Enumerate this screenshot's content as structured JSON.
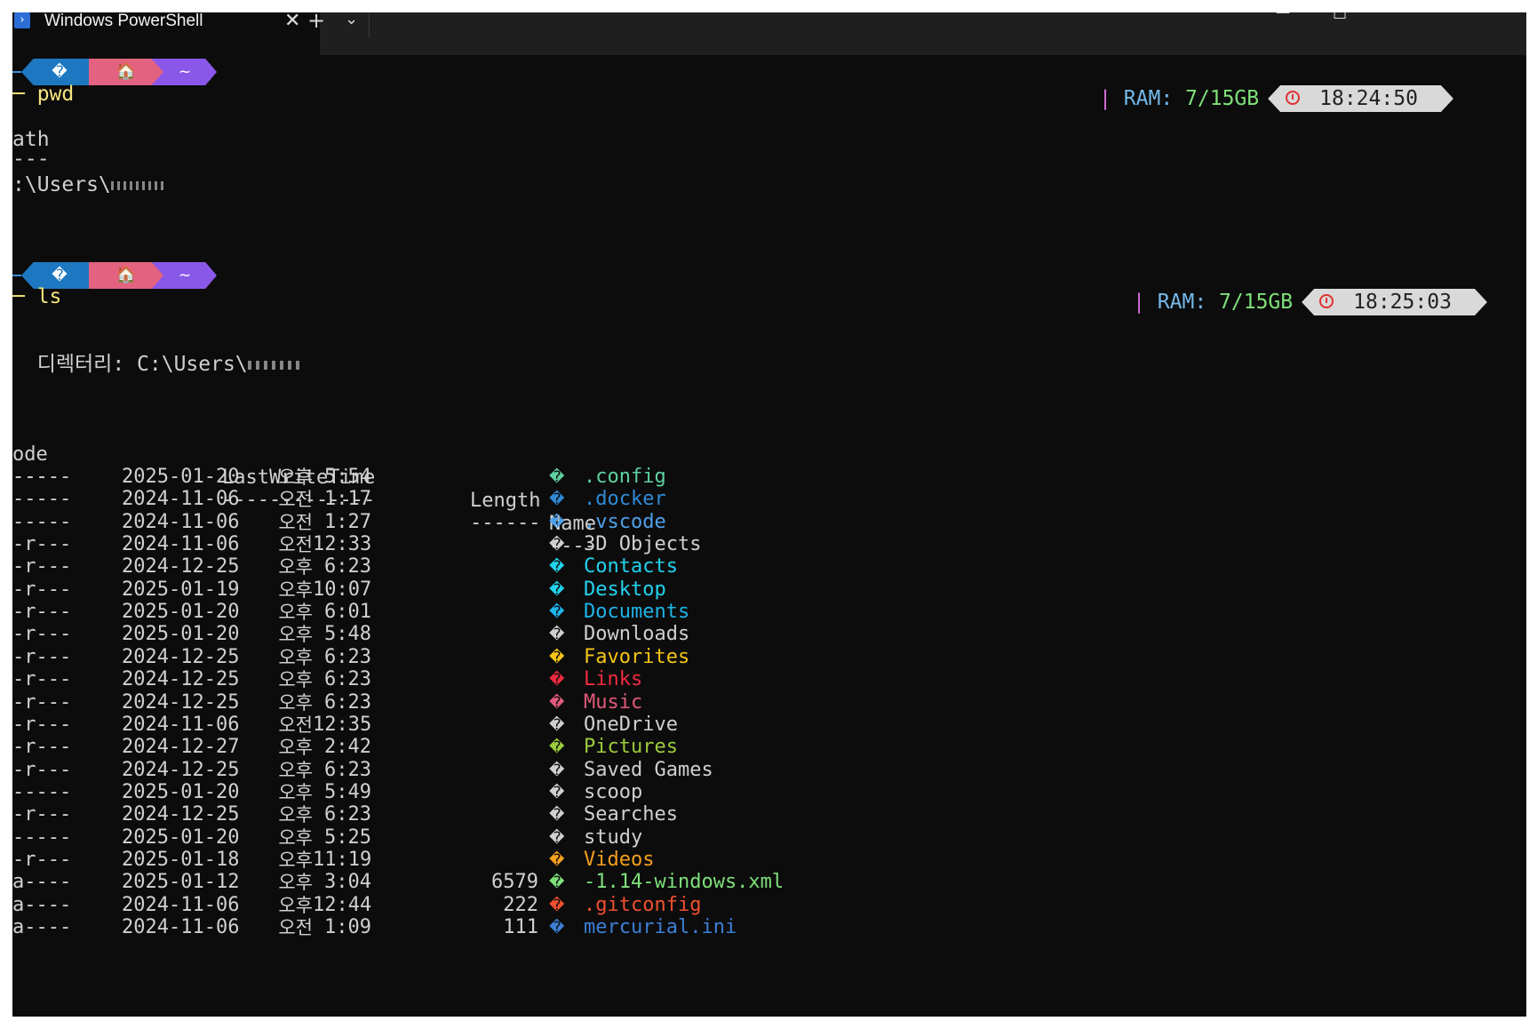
{
  "window": {
    "tab_title": "Windows PowerShell",
    "tab_icon": "powershell-icon",
    "close_glyph": "✕",
    "new_tab_glyph": "+",
    "dropdown_glyph": "⌄",
    "minimize_glyph": "—",
    "maximize_glyph": "☐"
  },
  "prompt1": {
    "seg1_glyph": "�",
    "seg3_glyph": "~",
    "ram_label": "RAM:",
    "ram_value": "7/15GB",
    "time": "18:24:50",
    "command": "─ pwd"
  },
  "pwd_output": {
    "header": "ath",
    "underline": "---",
    "path": ":\\Users\\"
  },
  "prompt2": {
    "seg1_glyph": "�",
    "seg3_glyph": "~",
    "ram_label": "RAM:",
    "ram_value": "7/15GB",
    "time": "18:25:03",
    "command": "─ ls"
  },
  "ls": {
    "directory_line": "  디렉터리: C:\\Users\\",
    "headers": {
      "mode": "ode",
      "lastwrite": "LastWriteTime",
      "length": "Length",
      "name": "Name"
    },
    "underlines": {
      "mode": "---",
      "lastwrite": "-------------",
      "length": "------",
      "name": "----"
    },
    "rows": [
      {
        "mode": "-----",
        "date": "2025-01-20",
        "ampm": "오후",
        "time": "5:54",
        "length": "",
        "icon": "�",
        "name": ".config",
        "color": "#5fd0a0"
      },
      {
        "mode": "-----",
        "date": "2024-11-06",
        "ampm": "오전",
        "time": "1:17",
        "length": "",
        "icon": "�",
        "name": ".docker",
        "color": "#2f8ad6"
      },
      {
        "mode": "-----",
        "date": "2024-11-06",
        "ampm": "오전",
        "time": "1:27",
        "length": "",
        "icon": "�",
        "name": ".vscode",
        "color": "#4ea0e8"
      },
      {
        "mode": "-r---",
        "date": "2024-11-06",
        "ampm": "오전",
        "time": "12:33",
        "length": "",
        "icon": "�",
        "name": "3D Objects",
        "color": "#d0d0d0"
      },
      {
        "mode": "-r---",
        "date": "2024-12-25",
        "ampm": "오후",
        "time": "6:23",
        "length": "",
        "icon": "�",
        "name": "Contacts",
        "color": "#22d3ee"
      },
      {
        "mode": "-r---",
        "date": "2025-01-19",
        "ampm": "오후",
        "time": "10:07",
        "length": "",
        "icon": "�",
        "name": "Desktop",
        "color": "#22d3ee"
      },
      {
        "mode": "-r---",
        "date": "2025-01-20",
        "ampm": "오후",
        "time": "6:01",
        "length": "",
        "icon": "�",
        "name": "Documents",
        "color": "#1fb3e8"
      },
      {
        "mode": "-r---",
        "date": "2025-01-20",
        "ampm": "오후",
        "time": "5:48",
        "length": "",
        "icon": "�",
        "name": "Downloads",
        "color": "#d0d0d0"
      },
      {
        "mode": "-r---",
        "date": "2024-12-25",
        "ampm": "오후",
        "time": "6:23",
        "length": "",
        "icon": "�",
        "name": "Favorites",
        "color": "#f5c518"
      },
      {
        "mode": "-r---",
        "date": "2024-12-25",
        "ampm": "오후",
        "time": "6:23",
        "length": "",
        "icon": "�",
        "name": "Links",
        "color": "#ef2b3f"
      },
      {
        "mode": "-r---",
        "date": "2024-12-25",
        "ampm": "오후",
        "time": "6:23",
        "length": "",
        "icon": "�",
        "name": "Music",
        "color": "#e05a7a"
      },
      {
        "mode": "-r---",
        "date": "2024-11-06",
        "ampm": "오전",
        "time": "12:35",
        "length": "",
        "icon": "�",
        "name": "OneDrive",
        "color": "#d0d0d0"
      },
      {
        "mode": "-r---",
        "date": "2024-12-27",
        "ampm": "오후",
        "time": "2:42",
        "length": "",
        "icon": "�",
        "name": "Pictures",
        "color": "#9ccc3c"
      },
      {
        "mode": "-r---",
        "date": "2024-12-25",
        "ampm": "오후",
        "time": "6:23",
        "length": "",
        "icon": "�",
        "name": "Saved Games",
        "color": "#d0d0d0"
      },
      {
        "mode": "-----",
        "date": "2025-01-20",
        "ampm": "오후",
        "time": "5:49",
        "length": "",
        "icon": "�",
        "name": "scoop",
        "color": "#d0d0d0"
      },
      {
        "mode": "-r---",
        "date": "2024-12-25",
        "ampm": "오후",
        "time": "6:23",
        "length": "",
        "icon": "�",
        "name": "Searches",
        "color": "#d0d0d0"
      },
      {
        "mode": "-----",
        "date": "2025-01-20",
        "ampm": "오후",
        "time": "5:25",
        "length": "",
        "icon": "�",
        "name": "study",
        "color": "#d0d0d0"
      },
      {
        "mode": "-r---",
        "date": "2025-01-18",
        "ampm": "오후",
        "time": "11:19",
        "length": "",
        "icon": "�",
        "name": "Videos",
        "color": "#f5a020"
      },
      {
        "mode": "a----",
        "date": "2025-01-12",
        "ampm": "오후",
        "time": "3:04",
        "length": "6579",
        "icon": "�",
        "name": "-1.14-windows.xml",
        "color": "#7ee07a"
      },
      {
        "mode": "a----",
        "date": "2024-11-06",
        "ampm": "오후",
        "time": "12:44",
        "length": "222",
        "icon": "�",
        "name": ".gitconfig",
        "color": "#f05030"
      },
      {
        "mode": "a----",
        "date": "2024-11-06",
        "ampm": "오전",
        "time": "1:09",
        "length": "111",
        "icon": "�",
        "name": "mercurial.ini",
        "color": "#3d7fd6"
      }
    ]
  }
}
